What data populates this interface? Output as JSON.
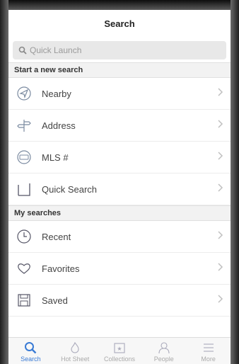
{
  "header": {
    "title": "Search"
  },
  "search": {
    "placeholder": "Quick Launch"
  },
  "sections": {
    "new_search": {
      "title": "Start a new search"
    },
    "my_searches": {
      "title": "My searches"
    }
  },
  "new_search_items": [
    {
      "label": "Nearby",
      "icon": "location-arrow-icon"
    },
    {
      "label": "Address",
      "icon": "signpost-icon"
    },
    {
      "label": "MLS #",
      "icon": "mls-badge-icon"
    },
    {
      "label": "Quick Search",
      "icon": "square-icon"
    }
  ],
  "my_search_items": [
    {
      "label": "Recent",
      "icon": "clock-icon"
    },
    {
      "label": "Favorites",
      "icon": "heart-icon"
    },
    {
      "label": "Saved",
      "icon": "floppy-disk-icon"
    }
  ],
  "tabbar": {
    "active": "Search",
    "tabs": [
      {
        "label": "Search",
        "icon": "magnifier-icon"
      },
      {
        "label": "Hot Sheet",
        "icon": "flame-icon"
      },
      {
        "label": "Collections",
        "icon": "star-folder-icon"
      },
      {
        "label": "People",
        "icon": "person-icon"
      },
      {
        "label": "More",
        "icon": "menu-icon"
      }
    ]
  },
  "colors": {
    "accent": "#3a7bd5",
    "icon_gray": "#7a8aa0"
  }
}
